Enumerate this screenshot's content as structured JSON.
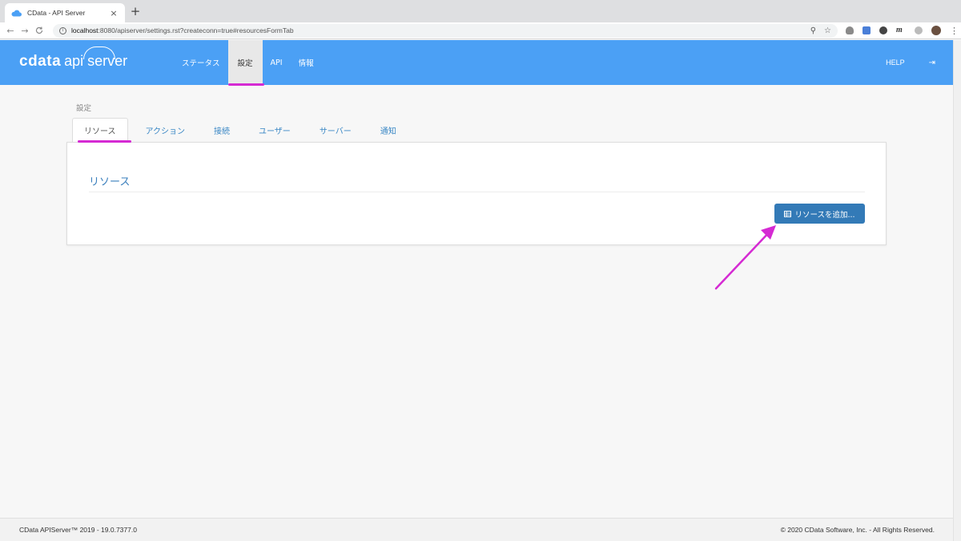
{
  "browser": {
    "tab_title": "CData - API Server",
    "close_glyph": "×",
    "new_tab_glyph": "+",
    "url_host": "localhost",
    "url_rest": ":8080/apiserver/settings.rst?createconn=true#resourcesFormTab",
    "back_glyph": "←",
    "forward_glyph": "→",
    "reload_glyph": "C",
    "zoom_glyph": "⚲",
    "star_glyph": "☆",
    "ext_m_glyph": "m",
    "menu_glyph": "⋮",
    "info_glyph": "i"
  },
  "header": {
    "logo_cdata": "cdata",
    "logo_api": "api server",
    "nav": [
      {
        "label": "ステータス"
      },
      {
        "label": "設定"
      },
      {
        "label": "API"
      },
      {
        "label": "情報"
      }
    ],
    "help_label": "HELP",
    "logout_glyph": "⇥",
    "brand_color": "#4ba0f5",
    "highlight_color": "#d52ad3"
  },
  "main": {
    "breadcrumb": "設定",
    "tabs": [
      {
        "label": "リソース"
      },
      {
        "label": "アクション"
      },
      {
        "label": "接続"
      },
      {
        "label": "ユーザー"
      },
      {
        "label": "サーバー"
      },
      {
        "label": "通知"
      }
    ],
    "panel_title": "リソース",
    "add_button_label": "リソースを追加...",
    "button_color": "#337ab7"
  },
  "footer": {
    "version": "CData APIServer™ 2019 - 19.0.7377.0",
    "copyright": "© 2020 CData Software, Inc. - All Rights Reserved."
  }
}
